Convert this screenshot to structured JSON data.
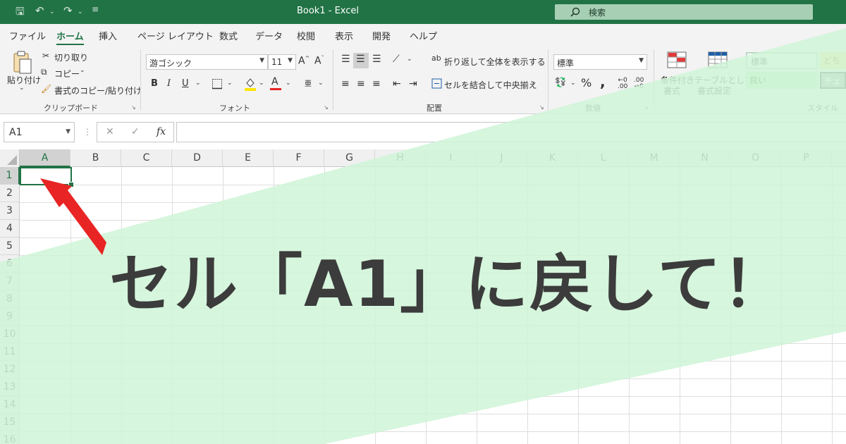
{
  "window": {
    "title": "Book1  -  Excel",
    "search_placeholder": "検索"
  },
  "ribbon_tabs": [
    "ファイル",
    "ホーム",
    "挿入",
    "ページ レイアウト",
    "数式",
    "データ",
    "校閲",
    "表示",
    "開発",
    "ヘルプ"
  ],
  "clipboard": {
    "paste_label": "貼り付け",
    "cut_label": "切り取り",
    "copy_label": "コピー",
    "format_painter_label": "書式のコピー/貼り付け",
    "group_label": "クリップボード"
  },
  "font": {
    "font_name": "游ゴシック",
    "font_size": "11",
    "bold": "B",
    "italic": "I",
    "underline": "U",
    "group_label": "フォント"
  },
  "alignment": {
    "wrap_text_label": "折り返して全体を表示する",
    "merge_center_label": "セルを結合して中央揃え",
    "group_label": "配置"
  },
  "number": {
    "format": "標準",
    "percent": "%",
    "comma": ",",
    "group_label": "数値"
  },
  "styles": {
    "conditional_format_label_1": "条件付き",
    "conditional_format_label_2": "書式",
    "table_format_label_1": "テーブルとして",
    "table_format_label_2": "書式設定",
    "style_normal": "標準",
    "style_good": "良い",
    "style_neutral": "どち",
    "style_check": "チェ",
    "group_label": "スタイル"
  },
  "formula_bar": {
    "name_box": "A1",
    "cancel": "✕",
    "enter": "✓",
    "fx": "fx",
    "formula": ""
  },
  "sheet": {
    "columns": [
      "A",
      "B",
      "C",
      "D",
      "E",
      "F",
      "G",
      "H",
      "I",
      "J",
      "K",
      "L",
      "M",
      "N",
      "O",
      "P"
    ],
    "rows": [
      "1",
      "2",
      "3",
      "4",
      "5",
      "6",
      "7",
      "8",
      "9",
      "10",
      "11",
      "12",
      "13",
      "14",
      "15",
      "16"
    ],
    "selected_cell": "A1"
  },
  "overlay": {
    "headline": "セル「A1」に戻して！"
  },
  "colors": {
    "excel_green": "#217346",
    "overlay_green": "#cff5d7",
    "arrow_red": "#e82424",
    "headline_text": "#3c3c3c"
  }
}
